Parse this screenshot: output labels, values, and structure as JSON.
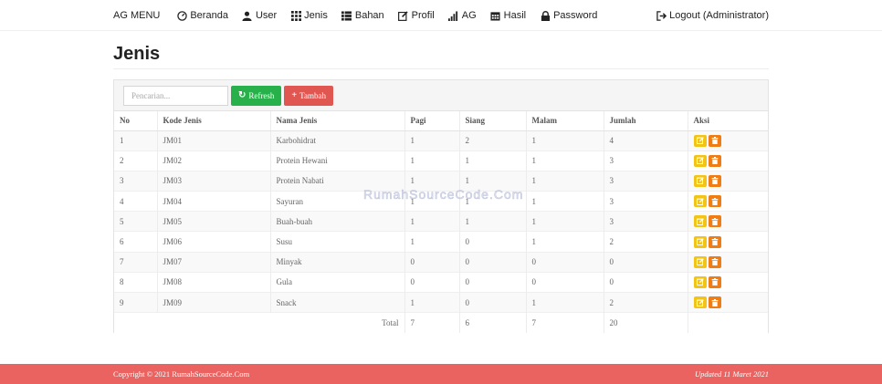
{
  "nav": {
    "brand": "AG MENU",
    "items": [
      {
        "label": "Beranda",
        "icon": "dashboard-icon"
      },
      {
        "label": "User",
        "icon": "user-icon"
      },
      {
        "label": "Jenis",
        "icon": "grid-icon"
      },
      {
        "label": "Bahan",
        "icon": "list-icon"
      },
      {
        "label": "Profil",
        "icon": "edit-icon"
      },
      {
        "label": "AG",
        "icon": "signal-icon"
      },
      {
        "label": "Hasil",
        "icon": "calendar-icon"
      },
      {
        "label": "Password",
        "icon": "lock-icon"
      }
    ],
    "logout": "Logout (Administrator)"
  },
  "page": {
    "title": "Jenis"
  },
  "toolbar": {
    "search_placeholder": "Pencarian...",
    "refresh_label": "Refresh",
    "tambah_label": "Tambah"
  },
  "table": {
    "headers": [
      "No",
      "Kode Jenis",
      "Nama Jenis",
      "Pagi",
      "Siang",
      "Malam",
      "Jumlah",
      "Aksi"
    ],
    "rows": [
      [
        "1",
        "JM01",
        "Karbohidrat",
        "1",
        "2",
        "1",
        "4"
      ],
      [
        "2",
        "JM02",
        "Protein Hewani",
        "1",
        "1",
        "1",
        "3"
      ],
      [
        "3",
        "JM03",
        "Protein Nabati",
        "1",
        "1",
        "1",
        "3"
      ],
      [
        "4",
        "JM04",
        "Sayuran",
        "1",
        "1",
        "1",
        "3"
      ],
      [
        "5",
        "JM05",
        "Buah-buah",
        "1",
        "1",
        "1",
        "3"
      ],
      [
        "6",
        "JM06",
        "Susu",
        "1",
        "0",
        "1",
        "2"
      ],
      [
        "7",
        "JM07",
        "Minyak",
        "0",
        "0",
        "0",
        "0"
      ],
      [
        "8",
        "JM08",
        "Gula",
        "0",
        "0",
        "0",
        "0"
      ],
      [
        "9",
        "JM09",
        "Snack",
        "1",
        "0",
        "1",
        "2"
      ]
    ],
    "total": {
      "label": "Total",
      "pagi": "7",
      "siang": "6",
      "malam": "7",
      "jumlah": "20"
    }
  },
  "watermark": "RumahSourceCode.Com",
  "footer": {
    "copyright": "Copyright © 2021 RumahSourceCode.Com",
    "updated": "Updated 11 Maret 2021"
  },
  "colors": {
    "refresh": "#28b04a",
    "tambah": "#e05752",
    "edit": "#f2c418",
    "delete": "#f07c14",
    "footer": "#ea6360"
  }
}
